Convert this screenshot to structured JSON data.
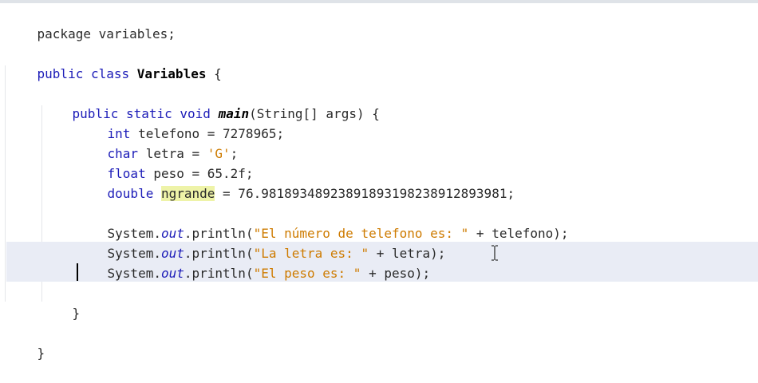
{
  "editor": {
    "lines": [
      [
        "package variables;"
      ],
      [
        "public class ",
        "Variables",
        " {"
      ],
      [
        "public static void ",
        "main",
        "(String[] args) {"
      ],
      [
        "int",
        " telefono = 7278965;"
      ],
      [
        "char",
        " letra = ",
        "'G'",
        ";"
      ],
      [
        "float",
        " peso = 65.2f;"
      ],
      [
        "double",
        " ",
        "ngrande",
        " = 76.98189348923891893198238912893981;"
      ],
      [
        "System.",
        "out",
        ".println(",
        "\"El número de telefono es: \"",
        " + telefono);"
      ],
      [
        "System.",
        "out",
        ".println(",
        "\"La letra es: \"",
        " + letra);"
      ],
      [
        "System.",
        "out",
        ".println(",
        "\"El peso es: \"",
        " + peso);"
      ],
      [
        "}"
      ],
      [
        "}"
      ]
    ]
  },
  "colors": {
    "keyword": "#1c1cb8",
    "string": "#ce7b00",
    "highlight": "#eef3a8",
    "current_line": "#e9ecf5"
  },
  "icons": {
    "cursor": "i-beam-cursor-icon"
  }
}
